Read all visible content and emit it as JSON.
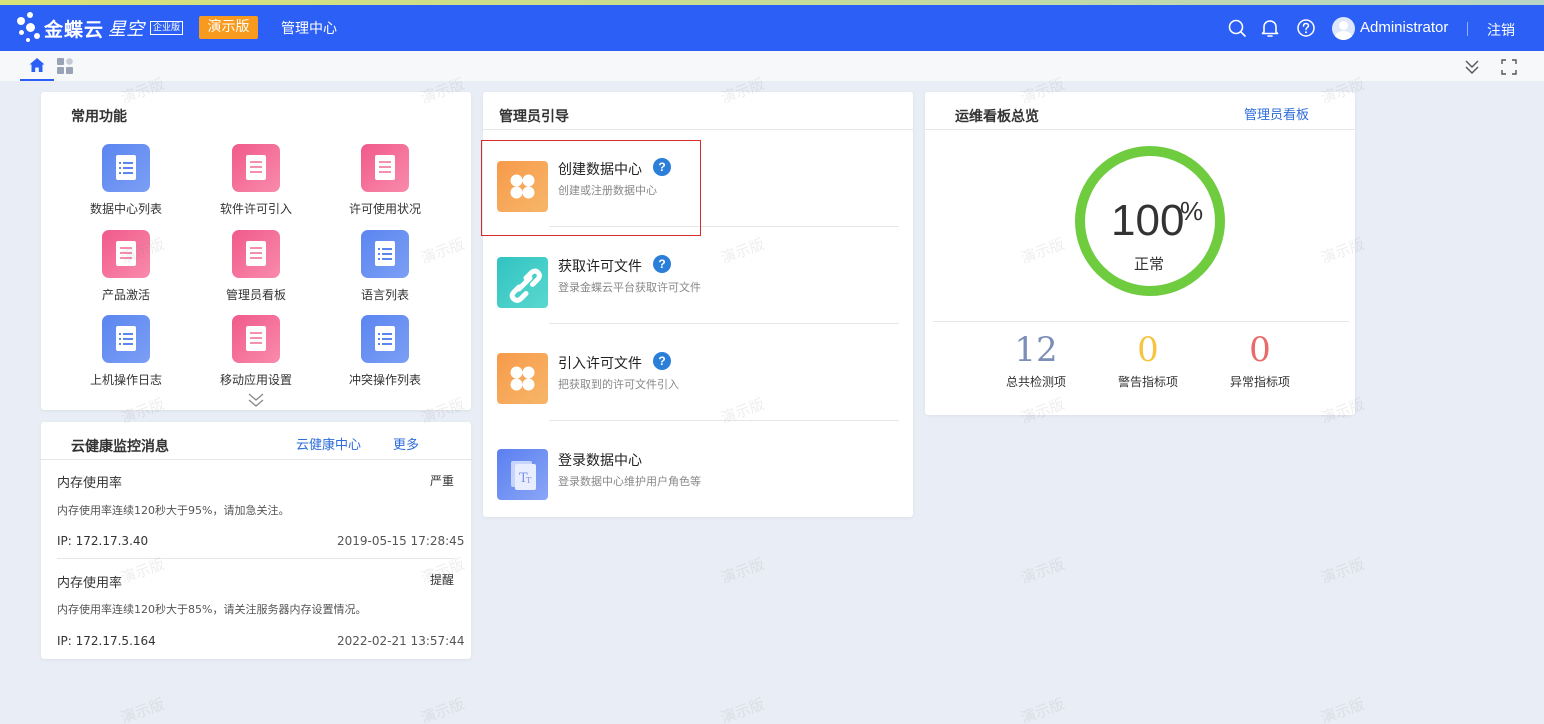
{
  "header": {
    "brand_name": "金蝶云",
    "brand_sub": "星空",
    "edition_badge": "企业版",
    "demo_tag": "演示版",
    "admin_center": "管理中心",
    "username": "Administrator",
    "logout": "注销",
    "icons": [
      "search-icon",
      "bell-icon",
      "help-icon"
    ]
  },
  "tabs": {
    "home_icon": "home-icon",
    "apps_icon": "apps-icon",
    "collapse_icon": "chevron-double-down-icon",
    "fullscreen_icon": "fullscreen-icon"
  },
  "common": {
    "title": "常用功能",
    "items": [
      {
        "label": "数据中心列表",
        "color": "blue"
      },
      {
        "label": "软件许可引入",
        "color": "pink"
      },
      {
        "label": "许可使用状况",
        "color": "pink"
      },
      {
        "label": "产品激活",
        "color": "pink"
      },
      {
        "label": "管理员看板",
        "color": "pink"
      },
      {
        "label": "语言列表",
        "color": "blue"
      },
      {
        "label": "上机操作日志",
        "color": "blue"
      },
      {
        "label": "移动应用设置",
        "color": "pink"
      },
      {
        "label": "冲突操作列表",
        "color": "blue"
      }
    ]
  },
  "health": {
    "title": "云健康监控消息",
    "link_center": "云健康中心",
    "link_more": "更多",
    "messages": [
      {
        "title": "内存使用率",
        "level": "严重",
        "desc": "内存使用率连续120秒大于95%，请加急关注。",
        "ip": "IP: 172.17.3.40",
        "time": "2019-05-15 17:28:45"
      },
      {
        "title": "内存使用率",
        "level": "提醒",
        "desc": "内存使用率连续120秒大于85%，请关注服务器内存设置情况。",
        "ip": "IP: 172.17.5.164",
        "time": "2022-02-21 13:57:44"
      }
    ]
  },
  "guide": {
    "title": "管理员引导",
    "steps": [
      {
        "name": "创建数据中心",
        "desc": "创建或注册数据中心",
        "help": "?"
      },
      {
        "name": "获取许可文件",
        "desc": "登录金蝶云平台获取许可文件",
        "help": "?"
      },
      {
        "name": "引入许可文件",
        "desc": "把获取到的许可文件引入",
        "help": "?"
      },
      {
        "name": "登录数据中心",
        "desc": "登录数据中心维护用户角色等"
      }
    ]
  },
  "ops": {
    "title": "运维看板总览",
    "link": "管理员看板",
    "gauge_value": "100",
    "gauge_unit": "%",
    "gauge_status": "正常",
    "gauge_fraction": 1.0,
    "stats": [
      {
        "value": "12",
        "label": "总共检测项",
        "color": "#7d8fb8"
      },
      {
        "value": "0",
        "label": "警告指标项",
        "color": "#f5c542"
      },
      {
        "value": "0",
        "label": "异常指标项",
        "color": "#e86a6a"
      }
    ],
    "colors": {
      "gauge": "#6fcc3f"
    }
  },
  "watermark": "演示版"
}
